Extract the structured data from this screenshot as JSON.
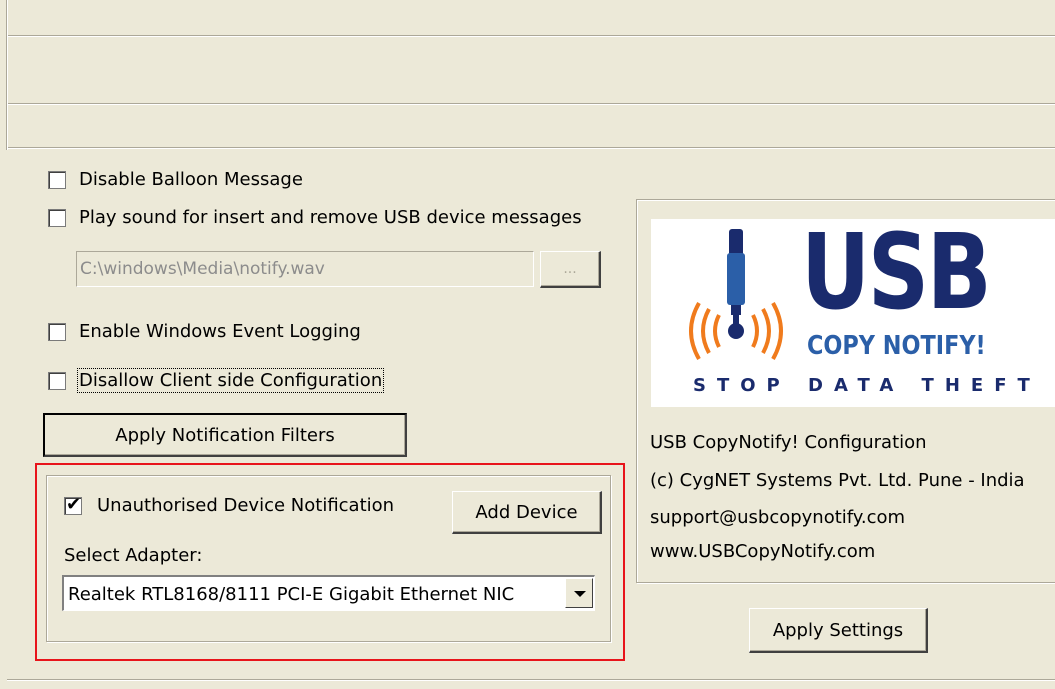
{
  "options": {
    "disable_balloon": {
      "label": "Disable Balloon Message",
      "checked": false
    },
    "play_sound": {
      "label": "Play sound for insert and remove USB device messages",
      "checked": false
    },
    "sound_path": {
      "value": "C:\\windows\\Media\\notify.wav"
    },
    "browse_button": {
      "label": "..."
    },
    "event_logging": {
      "label": "Enable Windows Event Logging",
      "checked": false
    },
    "disallow_client": {
      "label": "Disallow Client side Configuration",
      "checked": false
    },
    "apply_filters_button": {
      "label": "Apply Notification Filters"
    }
  },
  "unauthorised": {
    "label": "Unauthorised Device Notification",
    "checked": true,
    "check_glyph": "✔",
    "add_device_button": {
      "label": "Add Device"
    },
    "adapter_label": "Select Adapter:",
    "adapter_value": "Realtek RTL8168/8111 PCI-E Gigabit Ethernet NIC"
  },
  "logo": {
    "title": "USB",
    "subtitle": "COPY NOTIFY!",
    "tagline": "STOP DATA THEFT",
    "colors": {
      "navy": "#1a2b6d",
      "orange": "#f07b1d",
      "blue": "#2b5fa8"
    }
  },
  "info": {
    "line1": "USB CopyNotify! Configuration",
    "line2": "(c) CygNET Systems Pvt. Ltd. Pune - India ",
    "line3": "support@usbcopynotify.com",
    "line4": "www.USBCopyNotify.com"
  },
  "apply_settings_button": {
    "label": "Apply Settings"
  },
  "highlight_color": "#e8141b"
}
